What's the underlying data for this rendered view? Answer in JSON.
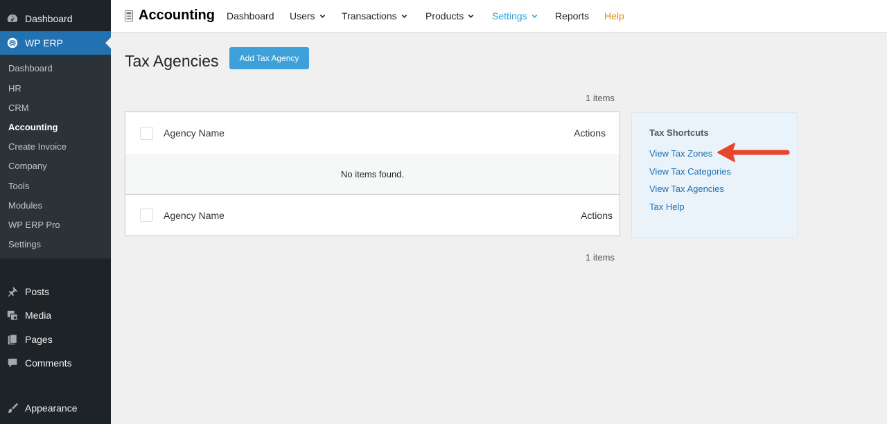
{
  "sidebar": {
    "top_items": [
      {
        "label": "Dashboard",
        "icon": "dashboard-icon"
      },
      {
        "label": "WP ERP",
        "icon": "wp-erp-icon",
        "current": true
      }
    ],
    "submenu": [
      {
        "label": "Dashboard"
      },
      {
        "label": "HR"
      },
      {
        "label": "CRM"
      },
      {
        "label": "Accounting",
        "current": true
      },
      {
        "label": "Create Invoice"
      },
      {
        "label": "Company"
      },
      {
        "label": "Tools"
      },
      {
        "label": "Modules"
      },
      {
        "label": "WP ERP Pro"
      },
      {
        "label": "Settings"
      }
    ],
    "bottom_items": [
      {
        "label": "Posts",
        "icon": "pin-icon"
      },
      {
        "label": "Media",
        "icon": "media-icon"
      },
      {
        "label": "Pages",
        "icon": "pages-icon"
      },
      {
        "label": "Comments",
        "icon": "comment-icon"
      },
      {
        "label": "Appearance",
        "icon": "brush-icon"
      }
    ]
  },
  "topnav": {
    "brand": "Accounting",
    "items": [
      {
        "label": "Dashboard"
      },
      {
        "label": "Users",
        "has_dropdown": true
      },
      {
        "label": "Transactions",
        "has_dropdown": true
      },
      {
        "label": "Products",
        "has_dropdown": true
      },
      {
        "label": "Settings",
        "has_dropdown": true,
        "active": true
      },
      {
        "label": "Reports"
      },
      {
        "label": "Help"
      }
    ]
  },
  "page": {
    "title": "Tax Agencies",
    "add_button": "Add Tax Agency",
    "items_count_top": "1 items",
    "items_count_bottom": "1 items"
  },
  "table": {
    "columns": {
      "name": "Agency Name",
      "actions": "Actions"
    },
    "empty_message": "No items found."
  },
  "shortcuts": {
    "title": "Tax Shortcuts",
    "links": [
      {
        "label": "View Tax Zones"
      },
      {
        "label": "View Tax Categories"
      },
      {
        "label": "View Tax Agencies"
      },
      {
        "label": "Tax Help"
      }
    ]
  },
  "colors": {
    "sidebar_bg": "#1d2327",
    "submenu_bg": "#2c3338",
    "accent": "#2271b1",
    "button": "#3ea0d8",
    "active_nav": "#2e9fd8",
    "help": "#e08a16",
    "annotation_arrow": "#e8452b"
  }
}
